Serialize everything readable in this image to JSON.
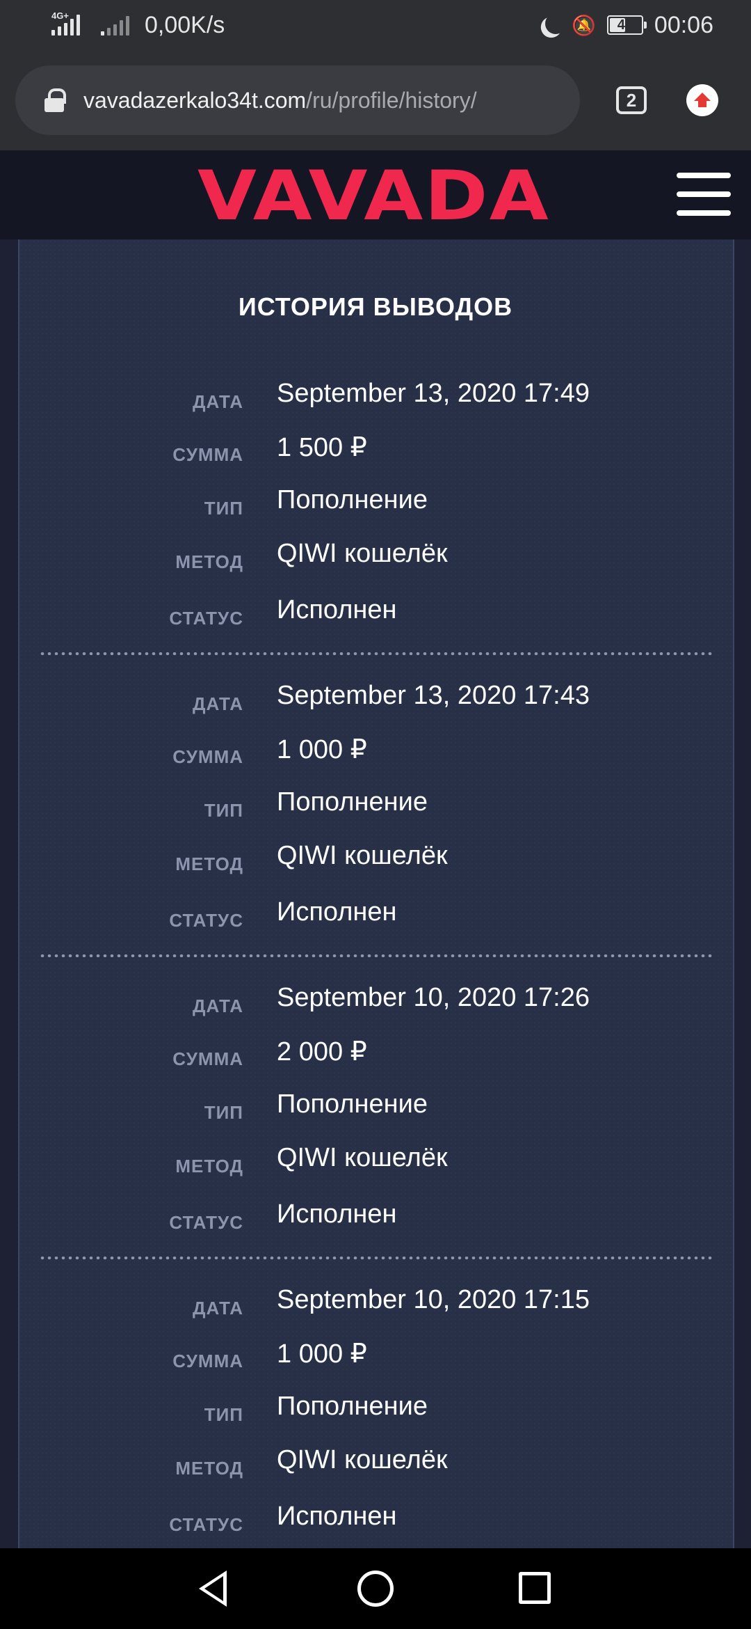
{
  "status_bar": {
    "network_tag": "4G+",
    "speed": "0,00K/s",
    "battery": "49",
    "time": "00:06"
  },
  "browser": {
    "url_host": "vavadazerkalo34t.com",
    "url_path": "/ru/profile/history/",
    "tab_count": "2"
  },
  "header": {
    "logo": "VAVADA"
  },
  "page": {
    "title": "ИСТОРИЯ ВЫВОДОВ",
    "labels": {
      "date": "ДАТА",
      "amount": "СУММА",
      "type": "ТИП",
      "method": "МЕТОД",
      "status": "СТАТУС"
    },
    "entries": [
      {
        "date": "September 13, 2020 17:49",
        "amount": "1 500 ₽",
        "type": "Пополнение",
        "method": "QIWI кошелёк",
        "status": "Исполнен"
      },
      {
        "date": "September 13, 2020 17:43",
        "amount": "1 000 ₽",
        "type": "Пополнение",
        "method": "QIWI кошелёк",
        "status": "Исполнен"
      },
      {
        "date": "September 10, 2020 17:26",
        "amount": "2 000 ₽",
        "type": "Пополнение",
        "method": "QIWI кошелёк",
        "status": "Исполнен"
      },
      {
        "date": "September 10, 2020 17:15",
        "amount": "1 000 ₽",
        "type": "Пополнение",
        "method": "QIWI кошелёк",
        "status": "Исполнен"
      }
    ]
  }
}
